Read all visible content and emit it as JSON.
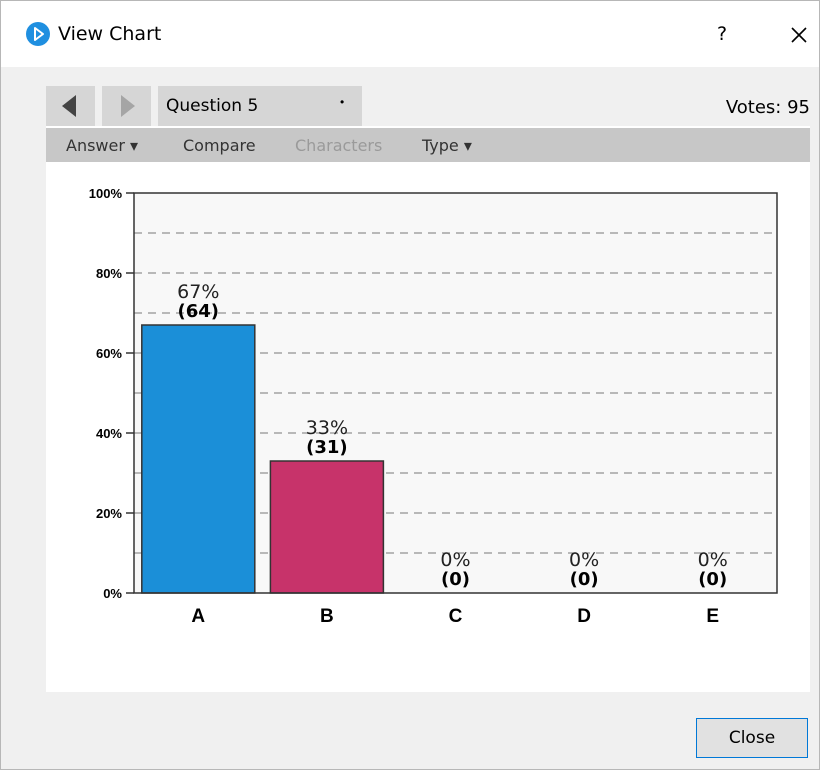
{
  "window": {
    "title": "View Chart",
    "help_label": "?",
    "close_label": "Close"
  },
  "nav": {
    "question": "Question 5",
    "votes": "Votes: 95"
  },
  "toolbar": {
    "answer": "Answer",
    "compare": "Compare",
    "characters": "Characters",
    "type": "Type"
  },
  "chart_data": {
    "type": "bar",
    "categories": [
      "A",
      "B",
      "C",
      "D",
      "E"
    ],
    "percents": [
      67,
      33,
      0,
      0,
      0
    ],
    "counts": [
      64,
      31,
      0,
      0,
      0
    ],
    "value_labels": [
      "67%",
      "33%",
      "0%",
      "0%",
      "0%"
    ],
    "count_labels": [
      "(64)",
      "(31)",
      "(0)",
      "(0)",
      "(0)"
    ],
    "colors": [
      "#1b8fd8",
      "#c7336a",
      "#c7336a",
      "#c7336a",
      "#c7336a"
    ],
    "ylim": [
      0,
      100
    ],
    "yticks": [
      "0%",
      "20%",
      "40%",
      "60%",
      "80%",
      "100%"
    ],
    "grid": true
  }
}
